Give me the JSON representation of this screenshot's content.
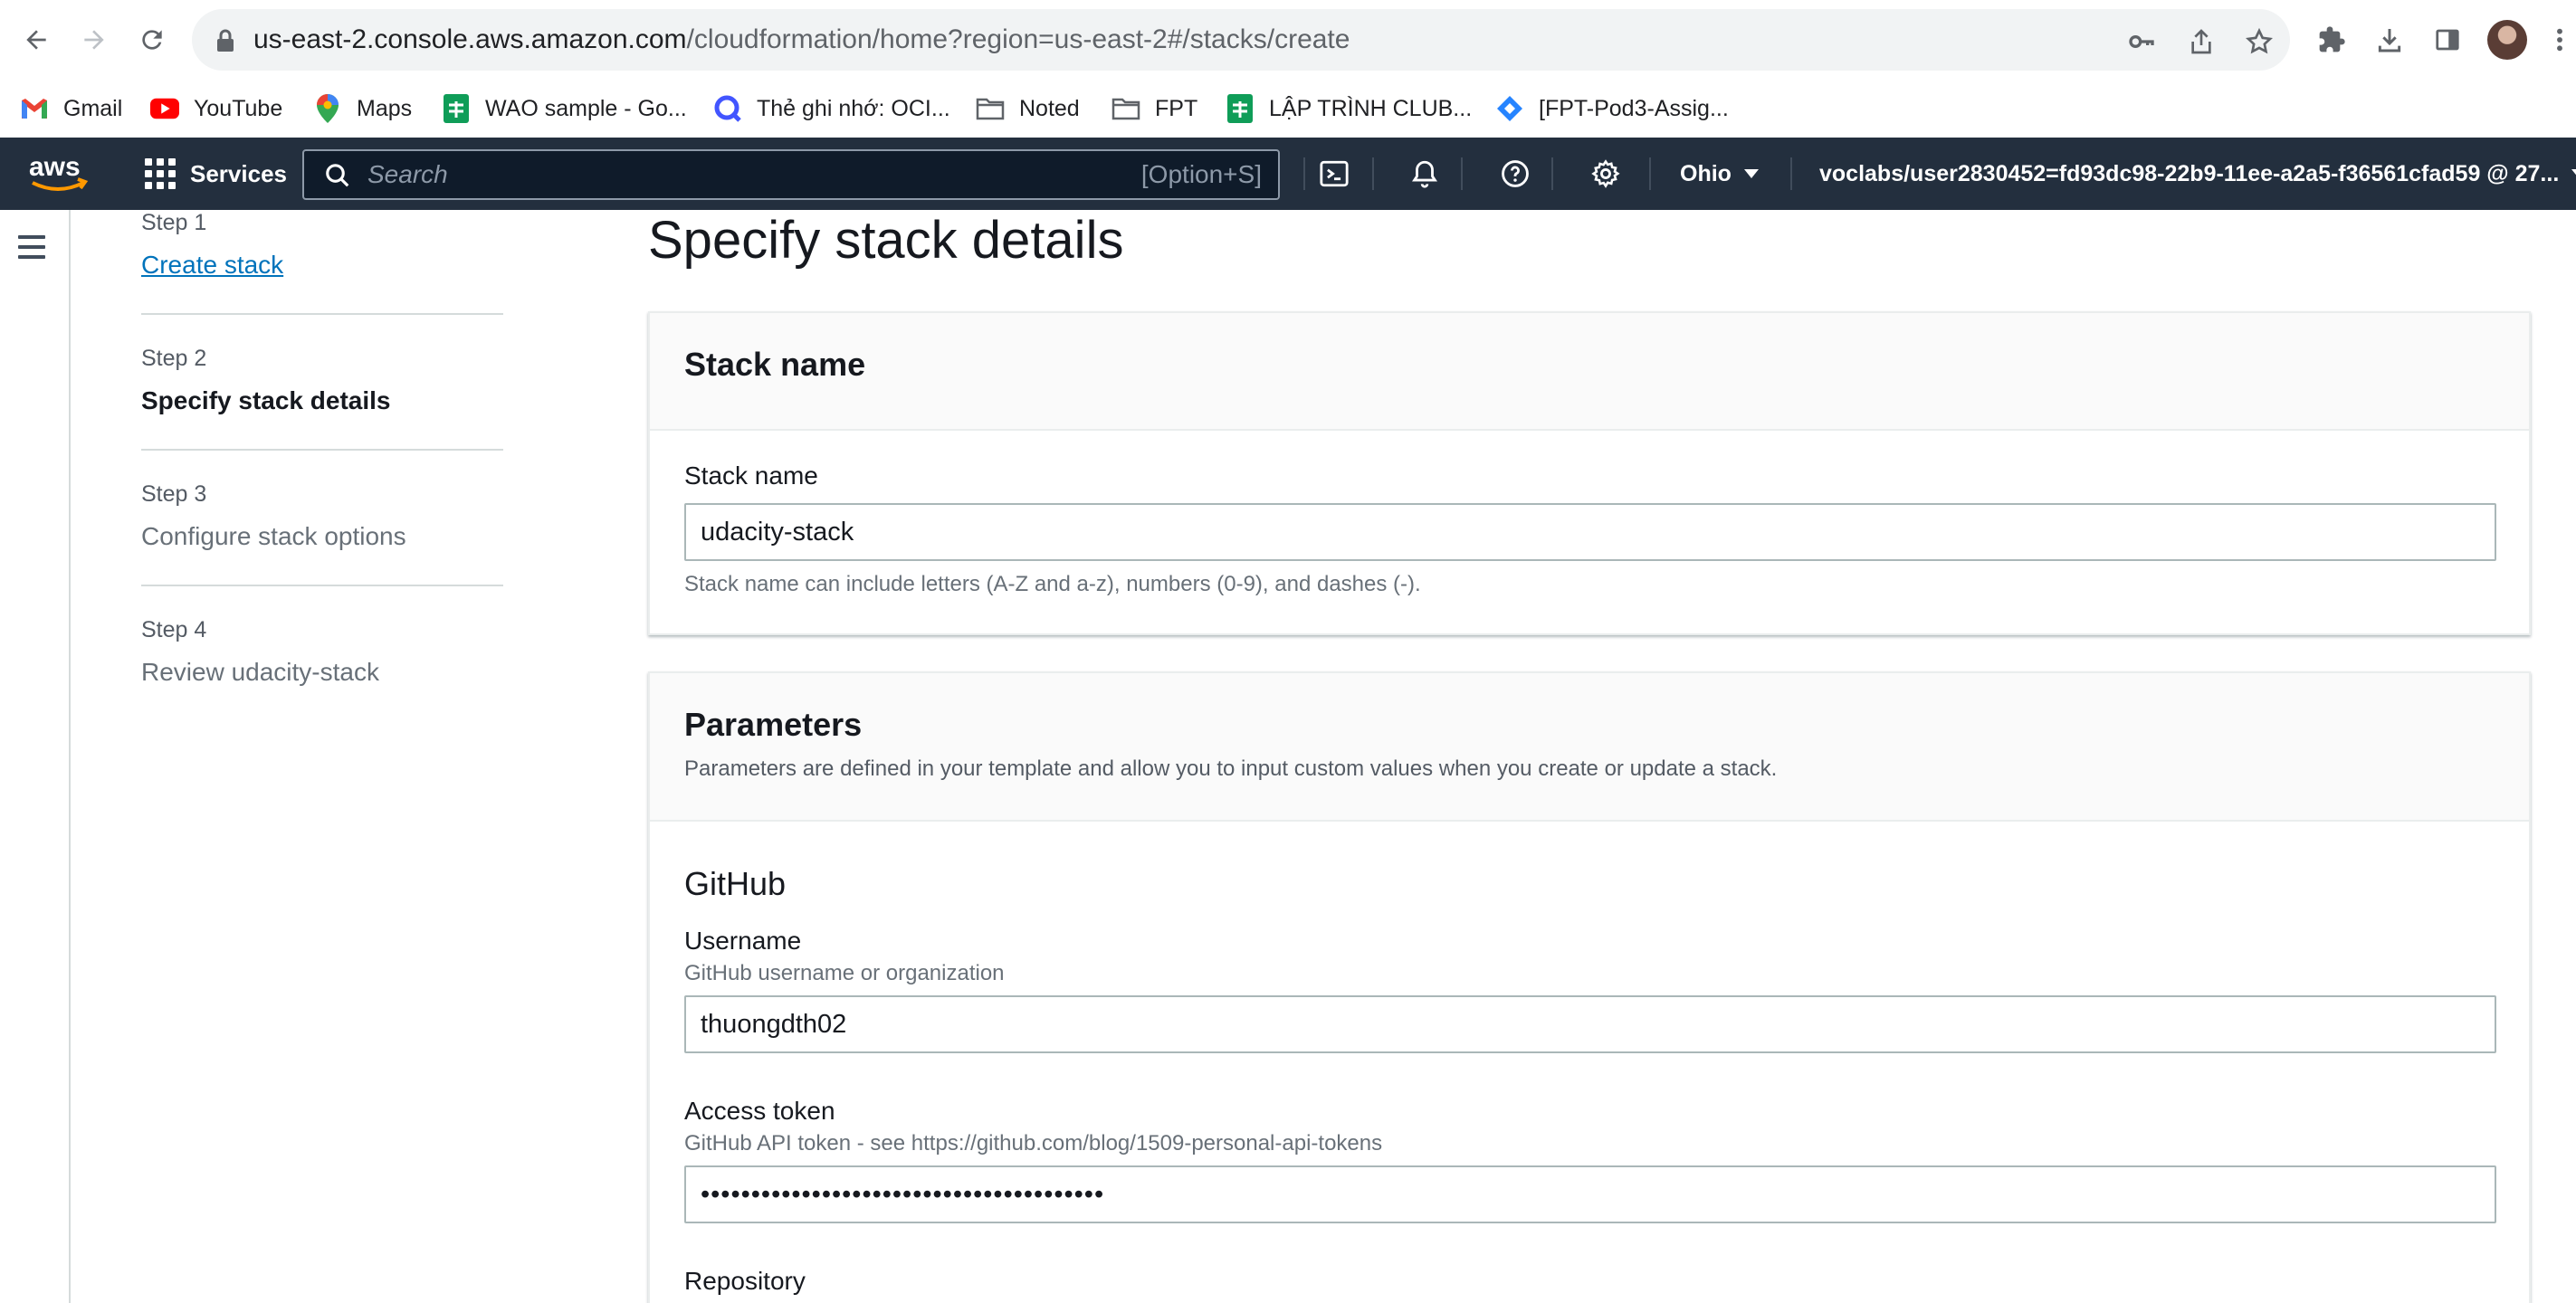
{
  "browser": {
    "url_host": "us-east-2.console.aws.amazon.com",
    "url_path": "/cloudformation/home?region=us-east-2#/stacks/create",
    "bookmarks": [
      {
        "label": "Gmail",
        "icon": "gmail-icon",
        "color": "#ea4335"
      },
      {
        "label": "YouTube",
        "icon": "youtube-icon",
        "color": "#ff0000"
      },
      {
        "label": "Maps",
        "icon": "maps-icon",
        "color": "#34a853"
      },
      {
        "label": "WAO sample - Go...",
        "icon": "sheets-icon",
        "color": "#0f9d58"
      },
      {
        "label": "Thẻ ghi nhớ: OCI...",
        "icon": "quizlet-icon",
        "color": "#4255ff"
      },
      {
        "label": "Noted",
        "icon": "folder-icon",
        "color": "#5f6368"
      },
      {
        "label": "FPT",
        "icon": "folder-icon",
        "color": "#5f6368"
      },
      {
        "label": "LẬP TRÌNH CLUB...",
        "icon": "sheets-icon",
        "color": "#0f9d58"
      },
      {
        "label": "[FPT-Pod3-Assig...",
        "icon": "jira-icon",
        "color": "#2684ff"
      }
    ]
  },
  "aws_nav": {
    "logo": "aws",
    "services_label": "Services",
    "search_placeholder": "Search",
    "search_shortcut": "[Option+S]",
    "region": "Ohio",
    "account": "voclabs/user2830452=fd93dc98-22b9-11ee-a2a5-f36561cfad59 @ 27..."
  },
  "steps": [
    {
      "num": "Step 1",
      "title": "Create stack",
      "state": "link"
    },
    {
      "num": "Step 2",
      "title": "Specify stack details",
      "state": "active"
    },
    {
      "num": "Step 3",
      "title": "Configure stack options",
      "state": "inactive"
    },
    {
      "num": "Step 4",
      "title": "Review udacity-stack",
      "state": "inactive"
    }
  ],
  "page_title": "Specify stack details",
  "stack_name_card": {
    "heading": "Stack name",
    "label": "Stack name",
    "value": "udacity-stack",
    "constraint": "Stack name can include letters (A-Z and a-z), numbers (0-9), and dashes (-)."
  },
  "parameters_card": {
    "heading": "Parameters",
    "description": "Parameters are defined in your template and allow you to input custom values when you create or update a stack.",
    "group": "GitHub",
    "username": {
      "label": "Username",
      "desc": "GitHub username or organization",
      "value": "thuongdth02"
    },
    "token": {
      "label": "Access token",
      "desc": "GitHub API token - see https://github.com/blog/1509-personal-api-tokens",
      "value": "••••••••••••••••••••••••••••••••••••••••"
    },
    "repository": {
      "label": "Repository"
    }
  },
  "colors": {
    "aws_nav_bg": "#232f3e",
    "link": "#0073bb",
    "aws_orange": "#ff9900"
  }
}
